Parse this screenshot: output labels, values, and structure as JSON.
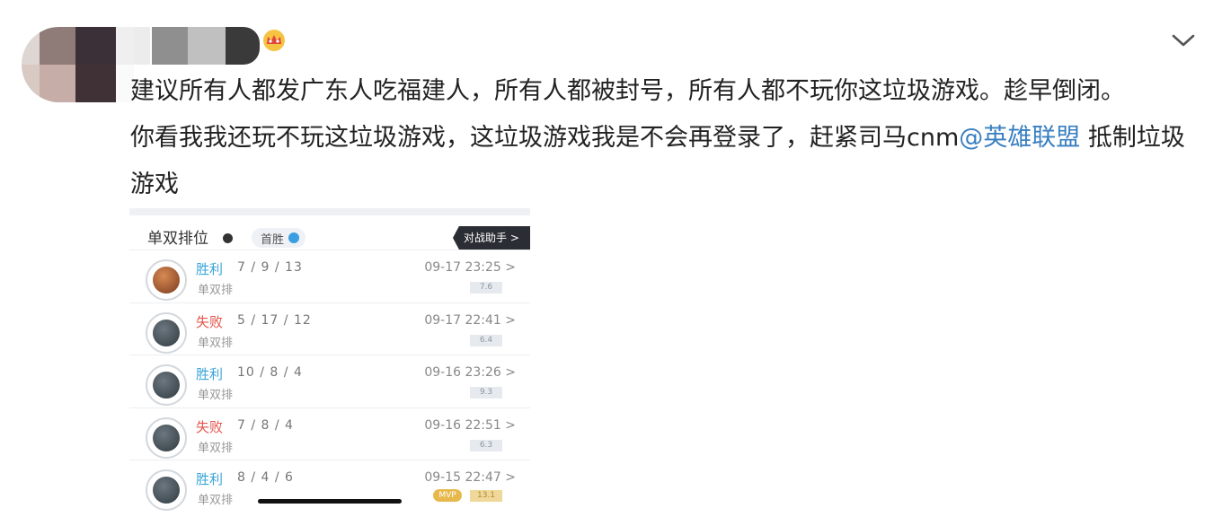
{
  "post": {
    "line1": "建议所有人都发广东人吃福建人，所有人都被封号，所有人都不玩你这垃圾游戏。趁早倒闭。",
    "line2_before": "你看我我还玩不玩这垃圾游戏，这垃圾游戏我是不会再登录了，赶紧司马cnm",
    "mention": "@英雄联盟",
    "line2_after": " 抵制垃圾游戏"
  },
  "icons": {
    "crown": "crown-icon",
    "expand": "chevron-down-icon"
  },
  "screenshot": {
    "tab_label": "单双排位",
    "pill_label": "首胜",
    "helper_label": "对战助手 >",
    "matches": [
      {
        "result": "胜利",
        "outcome": "win",
        "kda": "7 / 9 / 13",
        "mode": "单双排",
        "time": "09-17 23:25 >",
        "score": "7.6"
      },
      {
        "result": "失败",
        "outcome": "lose",
        "kda": "5 / 17 / 12",
        "mode": "单双排",
        "time": "09-17 22:41 >",
        "score": "6.4"
      },
      {
        "result": "胜利",
        "outcome": "win",
        "kda": "10 / 8 / 4",
        "mode": "单双排",
        "time": "09-16 23:26 >",
        "score": "9.3"
      },
      {
        "result": "失败",
        "outcome": "lose",
        "kda": "7 / 8 / 4",
        "mode": "单双排",
        "time": "09-16 22:51 >",
        "score": "6.3"
      },
      {
        "result": "胜利",
        "outcome": "win",
        "kda": "8 / 4 / 6",
        "mode": "单双排",
        "time": "09-15 22:47 >",
        "score": "13.1",
        "badge": "MVP"
      }
    ]
  },
  "colors": {
    "link": "#3a7fc1",
    "win": "#39a5d9",
    "lose": "#e2554d"
  }
}
